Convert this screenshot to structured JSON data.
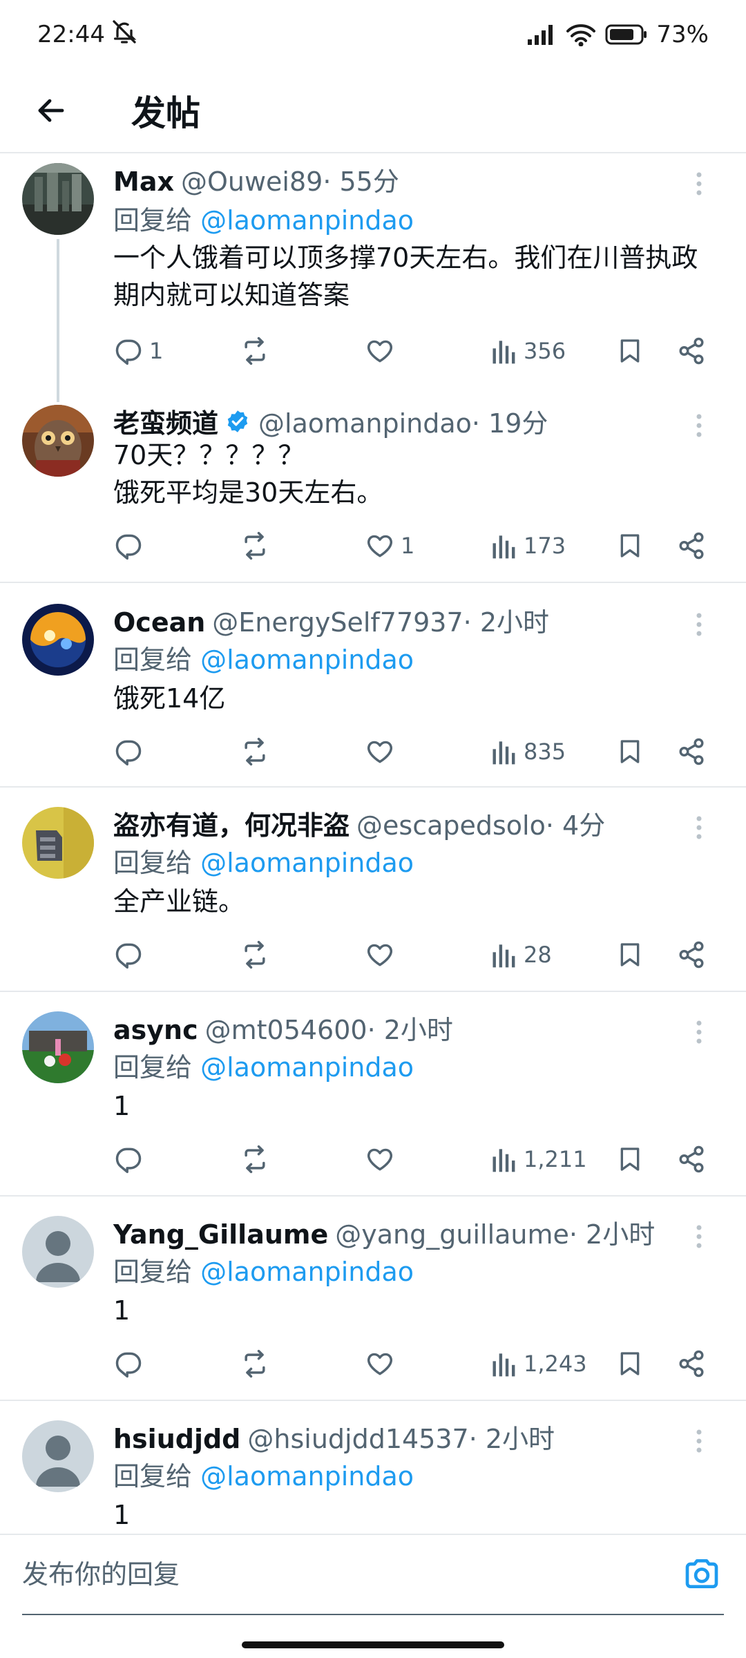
{
  "status_bar": {
    "time": "22:44",
    "battery_pct": "73%",
    "icons": [
      "mute-icon",
      "signal-icon",
      "wifi-icon",
      "battery-icon"
    ]
  },
  "header": {
    "back_icon": "arrow-left-icon",
    "title": "发帖"
  },
  "colors": {
    "accent": "#1d9bf0",
    "secondary_text": "#536471",
    "primary_text": "#0f1419",
    "divider": "#e6e9ec"
  },
  "tweets": [
    {
      "name": "Max",
      "handle": "@Ouwei89",
      "time": "· 55分",
      "reply_label": "回复给",
      "reply_to": "@laomanpindao",
      "text": "一个人饿着可以顶多撑70天左右。我们在川普执政期内就可以知道答案",
      "replies": "1",
      "retweets": "",
      "likes": "",
      "views": "356"
    },
    {
      "name": "老蛮频道",
      "verified": true,
      "handle": "@laomanpindao",
      "time": "· 19分",
      "text": "70天？？？？？\n饿死平均是30天左右。",
      "replies": "",
      "retweets": "",
      "likes": "1",
      "views": "173"
    },
    {
      "name": "Ocean",
      "handle": "@EnergySelf77937",
      "time": "· 2小时",
      "reply_label": "回复给",
      "reply_to": "@laomanpindao",
      "text": "饿死14亿",
      "replies": "",
      "retweets": "",
      "likes": "",
      "views": "835"
    },
    {
      "name": "盗亦有道，何况非盗",
      "handle": "@escapedsolo",
      "time": "· 4分",
      "reply_label": "回复给",
      "reply_to": "@laomanpindao",
      "text": "全产业链。",
      "replies": "",
      "retweets": "",
      "likes": "",
      "views": "28"
    },
    {
      "name": "async",
      "handle": "@mt054600",
      "time": "· 2小时",
      "reply_label": "回复给",
      "reply_to": "@laomanpindao",
      "text": "1",
      "replies": "",
      "retweets": "",
      "likes": "",
      "views": "1,211"
    },
    {
      "name": "Yang_Gillaume",
      "handle": "@yang_guillaume",
      "time": "· 2小时",
      "reply_label": "回复给",
      "reply_to": "@laomanpindao",
      "text": "1",
      "replies": "",
      "retweets": "",
      "likes": "",
      "views": "1,243"
    },
    {
      "name": "hsiudjdd",
      "handle": "@hsiudjdd14537",
      "time": "· 2小时",
      "reply_label": "回复给",
      "reply_to": "@laomanpindao",
      "text": "1"
    }
  ],
  "composer": {
    "placeholder": "发布你的回复",
    "camera_icon": "camera-icon"
  }
}
